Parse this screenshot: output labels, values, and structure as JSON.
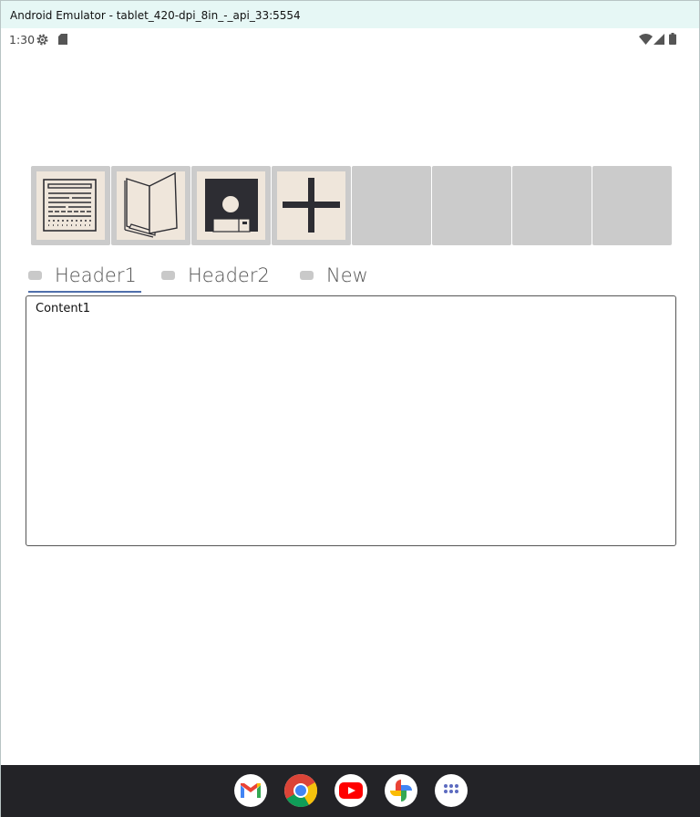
{
  "window": {
    "title": "Android Emulator - tablet_420-dpi_8in_-_api_33:5554"
  },
  "status_bar": {
    "time": "1:30",
    "left_icons": [
      "settings-gear-icon",
      "sd-card-icon"
    ],
    "right_icons": [
      "wifi-icon",
      "cellular-signal-icon",
      "battery-icon"
    ]
  },
  "toolbar": {
    "buttons": [
      {
        "name": "document-icon",
        "filled": true
      },
      {
        "name": "open-folder-icon",
        "filled": true
      },
      {
        "name": "save-floppy-icon",
        "filled": true
      },
      {
        "name": "add-plus-icon",
        "filled": true
      },
      {
        "name": "empty-slot",
        "filled": false
      },
      {
        "name": "empty-slot",
        "filled": false
      },
      {
        "name": "empty-slot",
        "filled": false
      },
      {
        "name": "empty-slot",
        "filled": false
      }
    ]
  },
  "tabs": [
    {
      "label": "Header1",
      "selected": true
    },
    {
      "label": "Header2",
      "selected": false
    },
    {
      "label": "New",
      "selected": false
    }
  ],
  "content": {
    "text": "Content1"
  },
  "dock": {
    "apps": [
      "gmail-icon",
      "chrome-icon",
      "youtube-icon",
      "photos-icon",
      "app-drawer-icon"
    ]
  },
  "colors": {
    "titlebar_bg": "#e6f7f5",
    "tab_indicator": "#4f6fab",
    "navbar_bg": "#232327",
    "icon_face": "#efe6db",
    "slot_bg": "#cbcbcb"
  }
}
